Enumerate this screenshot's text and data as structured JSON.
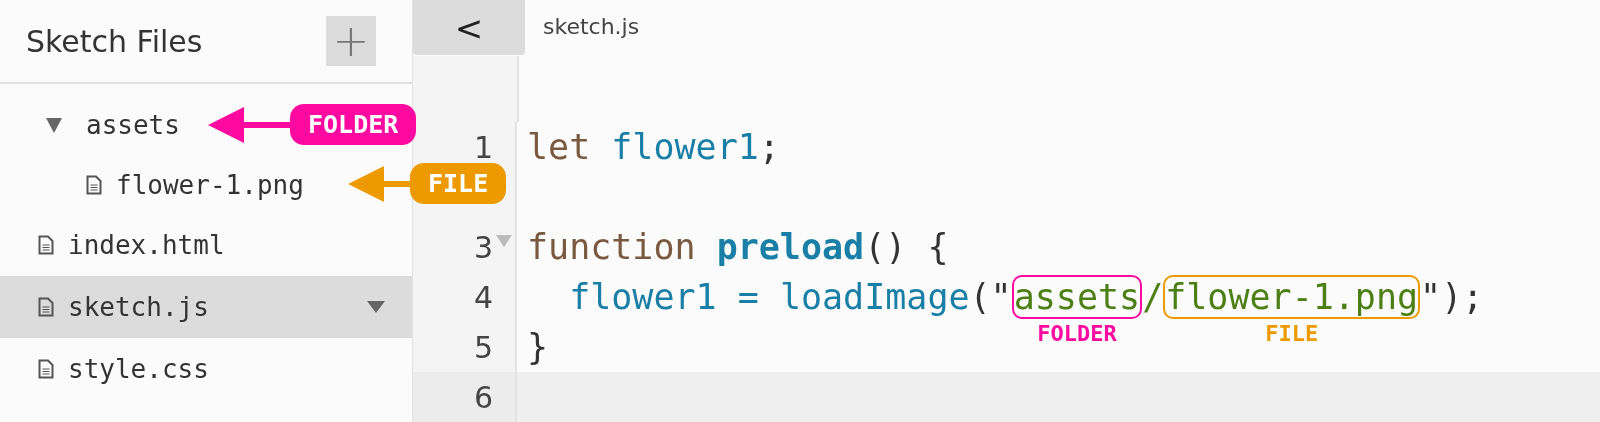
{
  "sidebar": {
    "title": "Sketch Files",
    "add_button": "+",
    "items": [
      {
        "kind": "folder",
        "name": "assets",
        "expanded": true,
        "selected": false,
        "children": [
          {
            "kind": "file",
            "name": "flower-1.png",
            "selected": false
          }
        ]
      },
      {
        "kind": "file",
        "name": "index.html",
        "selected": false
      },
      {
        "kind": "file",
        "name": "sketch.js",
        "selected": true
      },
      {
        "kind": "file",
        "name": "style.css",
        "selected": false
      }
    ]
  },
  "editor": {
    "back_button": "<",
    "tab": "sketch.js",
    "lines": [
      {
        "number": "1",
        "active": false,
        "foldable": false,
        "tokens": [
          {
            "kind": "keyword",
            "text": "let "
          },
          {
            "kind": "variable",
            "text": "flower1"
          },
          {
            "kind": "punct",
            "text": ";"
          }
        ]
      },
      {
        "active": false,
        "foldable": false
      },
      {
        "number": "3",
        "active": false,
        "foldable": true,
        "tokens": [
          {
            "kind": "keyword",
            "text": "function "
          },
          {
            "kind": "def",
            "text": "preload"
          },
          {
            "kind": "punct",
            "text": "() {"
          }
        ]
      },
      {
        "number": "4",
        "active": false,
        "foldable": false,
        "tokens": [
          {
            "kind": "variable",
            "text": "  flower1 = "
          },
          {
            "kind": "variable",
            "text": "loadImage"
          },
          {
            "kind": "punct",
            "text": "(\""
          },
          {
            "kind": "string",
            "text": "assets",
            "color": "#ff0aa0",
            "note": "FOLDER"
          },
          {
            "kind": "string",
            "text": "/"
          },
          {
            "kind": "string",
            "text": "flower-1.png",
            "color": "#ec9a00",
            "note": "FILE"
          },
          {
            "kind": "punct",
            "text": "\");"
          }
        ]
      },
      {
        "number": "5",
        "active": false,
        "foldable": false,
        "tokens": [
          {
            "kind": "punct",
            "text": "}"
          }
        ]
      },
      {
        "number": "6",
        "active": true,
        "foldable": false
      }
    ]
  },
  "callouts": [
    {
      "label": "FOLDER",
      "color": "#ff0aa0"
    },
    {
      "label": "FILE",
      "color": "#ec9a00"
    }
  ]
}
